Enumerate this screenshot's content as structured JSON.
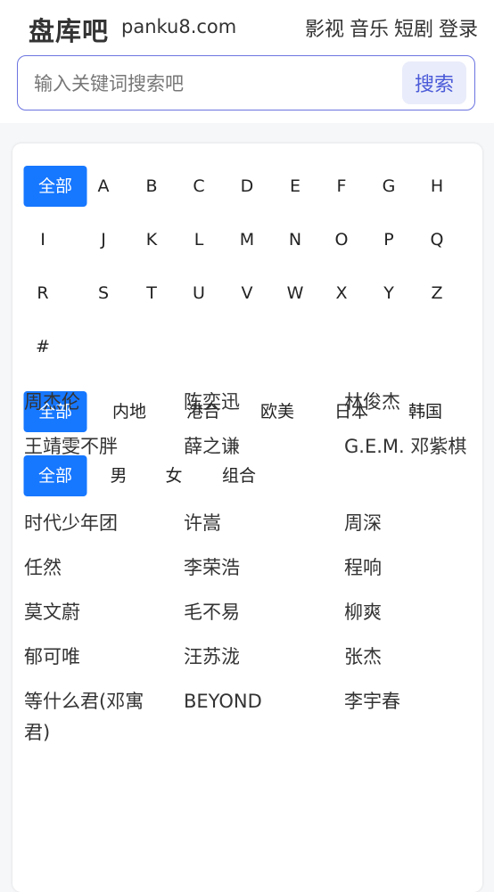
{
  "header": {
    "logo": "盘库吧",
    "domain": "panku8.com",
    "nav": [
      "影视",
      "音乐",
      "短剧",
      "登录"
    ]
  },
  "search": {
    "placeholder": "输入关键词搜索吧",
    "button": "搜索"
  },
  "filters": {
    "letters": [
      "全部",
      "A",
      "B",
      "C",
      "D",
      "E",
      "F",
      "G",
      "H",
      "I",
      "J",
      "K",
      "L",
      "M",
      "N",
      "O",
      "P",
      "Q",
      "R",
      "S",
      "T",
      "U",
      "V",
      "W",
      "X",
      "Y",
      "Z",
      "#"
    ],
    "regions": [
      "全部",
      "内地",
      "港台",
      "欧美",
      "日本",
      "韩国"
    ],
    "genders": [
      "全部",
      "男",
      "女",
      "组合"
    ]
  },
  "artists": [
    "周杰伦",
    "陈奕迅",
    "林俊杰",
    "王靖雯不胖",
    "薛之谦",
    "G.E.M. 邓紫棋",
    "时代少年团",
    "许嵩",
    "周深",
    "任然",
    "李荣浩",
    "程响",
    "莫文蔚",
    "毛不易",
    "柳爽",
    "郁可唯",
    "汪苏泷",
    "张杰",
    "等什么君(邓寓君)",
    "BEYOND",
    "李宇春"
  ],
  "colors": {
    "accent": "#1677ff",
    "search_border": "#6b74e0",
    "search_button_bg": "#e9ecfa",
    "search_button_text": "#4a5ad8"
  }
}
